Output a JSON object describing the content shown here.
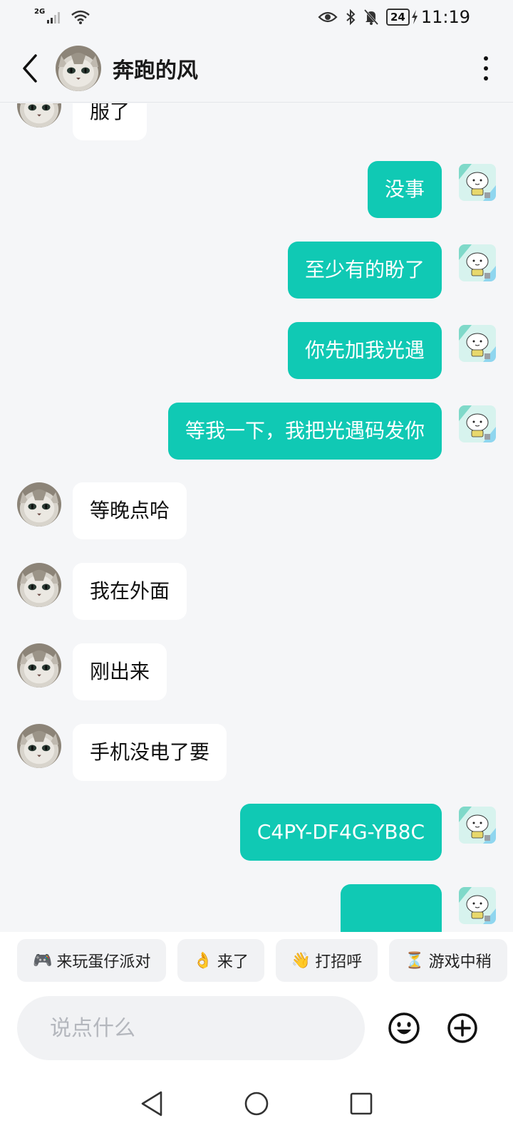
{
  "status_bar": {
    "network": "2G",
    "battery": "24",
    "time": "11:19"
  },
  "header": {
    "contact_name": "奔跑的风"
  },
  "messages": [
    {
      "side": "in",
      "text": "服了"
    },
    {
      "side": "out",
      "text": "没事"
    },
    {
      "side": "out",
      "text": "至少有的盼了"
    },
    {
      "side": "out",
      "text": "你先加我光遇"
    },
    {
      "side": "out",
      "text": "等我一下，我把光遇码发你"
    },
    {
      "side": "in",
      "text": "等晚点哈"
    },
    {
      "side": "in",
      "text": "我在外面"
    },
    {
      "side": "in",
      "text": "刚出来"
    },
    {
      "side": "in",
      "text": "手机没电了要"
    },
    {
      "side": "out",
      "text": "C4PY-DF4G-YB8C"
    },
    {
      "side": "out",
      "text": ""
    }
  ],
  "quick_replies": [
    {
      "emoji": "🎮",
      "label": "来玩蛋仔派对"
    },
    {
      "emoji": "👌",
      "label": "来了"
    },
    {
      "emoji": "👋",
      "label": "打招呼"
    },
    {
      "emoji": "⏳",
      "label": "游戏中稍"
    }
  ],
  "input": {
    "placeholder": "说点什么"
  },
  "colors": {
    "accent": "#10c9b4",
    "background": "#f5f6f8"
  }
}
